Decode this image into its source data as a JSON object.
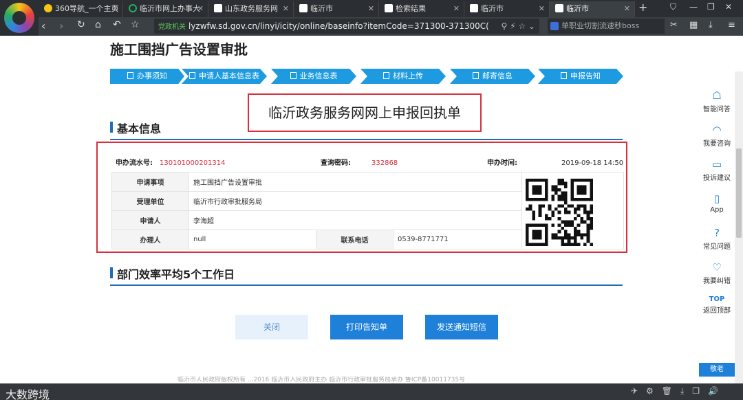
{
  "browser": {
    "tabs": [
      {
        "label": "360导航_一个主页",
        "icon": "360-icon"
      },
      {
        "label": "临沂市网上办事大",
        "icon": "loading-icon"
      },
      {
        "label": "山东政务服务网",
        "icon": "page-icon"
      },
      {
        "label": "临沂市",
        "icon": "page-icon"
      },
      {
        "label": "检索结果",
        "icon": "page-icon"
      },
      {
        "label": "临沂市",
        "icon": "page-icon"
      },
      {
        "label": "临沂市",
        "icon": "page-icon",
        "active": true
      }
    ],
    "gov_badge": "党政机关",
    "url": "lyzwfw.sd.gov.cn/linyi/icity/online/baseinfo?itemCode=371300-371300C(",
    "search_text": "单职业切割流速秒boss"
  },
  "page": {
    "title": "施工围挡广告设置审批",
    "steps": [
      "办事须知",
      "申请人基本信息表",
      "业务信息表",
      "材料上传",
      "邮寄信息",
      "申报告知"
    ],
    "receipt_title": "临沂政务服务网网上申报回执单",
    "section1": "基本信息",
    "meta": {
      "serial_label": "申办流水号:",
      "serial_value": "130101000201314",
      "query_label": "查询密码:",
      "query_value": "332868",
      "time_label": "申办时间:",
      "time_value": "2019-09-18 14:50"
    },
    "table": {
      "item_label": "申请事项",
      "item_value": "施工围挡广告设置审批",
      "org_label": "受理单位",
      "org_value": "临沂市行政审批服务局",
      "applicant_label": "申请人",
      "applicant_value": "李海超",
      "handler_label": "办理人",
      "handler_value": "null",
      "phone_label": "联系电话",
      "phone_value": "0539-8771771"
    },
    "section2": "部门效率平均5个工作日",
    "buttons": {
      "close": "关闭",
      "print": "打印告知单",
      "sms": "发送通知短信"
    },
    "footer": "临沂市人民政府版权所有   ...2016   临沂市人民政府主办   临沂市行政审批服务局承办   鲁ICP备10011735号"
  },
  "sidebar": {
    "items": [
      {
        "label": "智能问答",
        "icon": "robot-icon"
      },
      {
        "label": "我要咨询",
        "icon": "headset-icon"
      },
      {
        "label": "投诉建议",
        "icon": "message-icon"
      },
      {
        "label": "App",
        "icon": "phone-icon"
      },
      {
        "label": "常见问题",
        "icon": "question-icon"
      },
      {
        "label": "我要纠错",
        "icon": "heart-icon"
      },
      {
        "label": "返回顶部",
        "icon": "top-icon"
      }
    ],
    "top_glyph": "TOP",
    "elder": "敬老"
  },
  "watermark": "大数跨境",
  "colors": {
    "accent": "#1e80d8",
    "highlight": "#d9303c"
  }
}
